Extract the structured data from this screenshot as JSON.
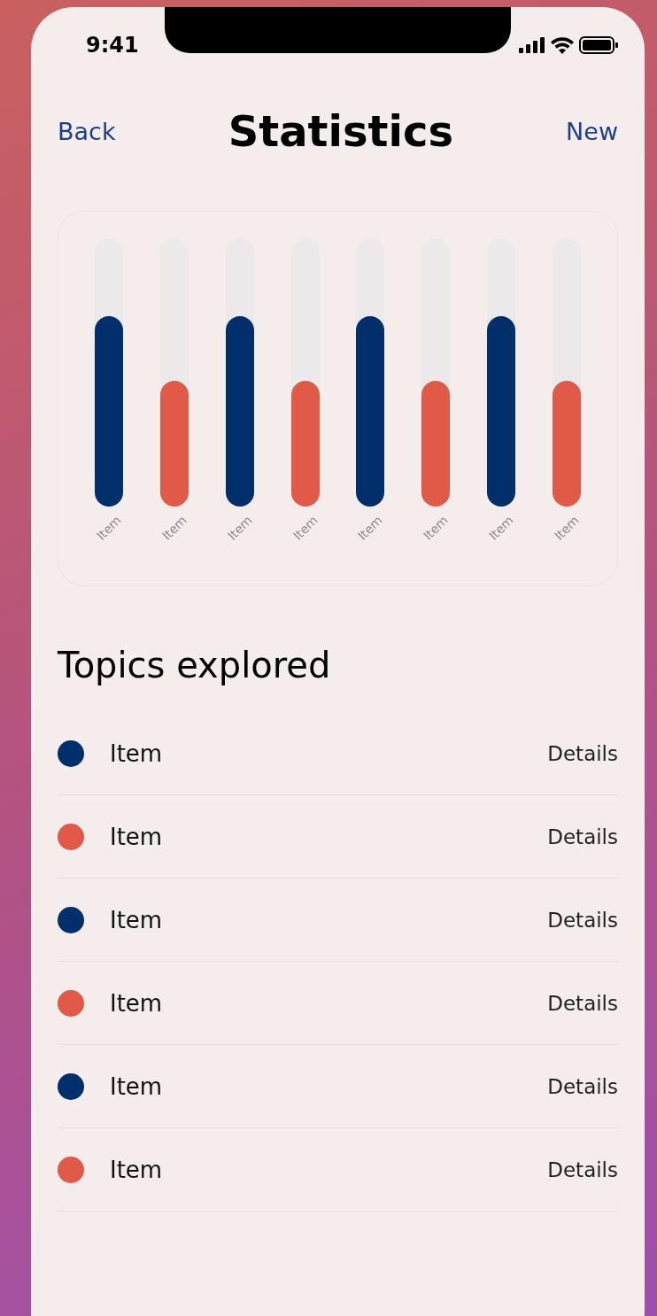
{
  "status_bar": {
    "time": "9:41"
  },
  "nav": {
    "back": "Back",
    "title": "Statistics",
    "action": "New"
  },
  "bars": [
    {
      "label": "Item",
      "level": 0.71,
      "color": "#002f6c"
    },
    {
      "label": "Item",
      "level": 0.47,
      "color": "#e05a47"
    },
    {
      "label": "Item",
      "level": 0.71,
      "color": "#002f6c"
    },
    {
      "label": "Item",
      "level": 0.47,
      "color": "#e05a47"
    },
    {
      "label": "Item",
      "level": 0.71,
      "color": "#002f6c"
    },
    {
      "label": "Item",
      "level": 0.47,
      "color": "#e05a47"
    },
    {
      "label": "Item",
      "level": 0.71,
      "color": "#002f6c"
    },
    {
      "label": "Item",
      "level": 0.47,
      "color": "#e05a47"
    }
  ],
  "section_title": "Topics explored",
  "topics": [
    {
      "label": "Item",
      "action": "Details",
      "color": "#002f6c"
    },
    {
      "label": "Item",
      "action": "Details",
      "color": "#e05a47"
    },
    {
      "label": "Item",
      "action": "Details",
      "color": "#002f6c"
    },
    {
      "label": "Item",
      "action": "Details",
      "color": "#e05a47"
    },
    {
      "label": "Item",
      "action": "Details",
      "color": "#002f6c"
    },
    {
      "label": "Item",
      "action": "Details",
      "color": "#e05a47"
    }
  ]
}
